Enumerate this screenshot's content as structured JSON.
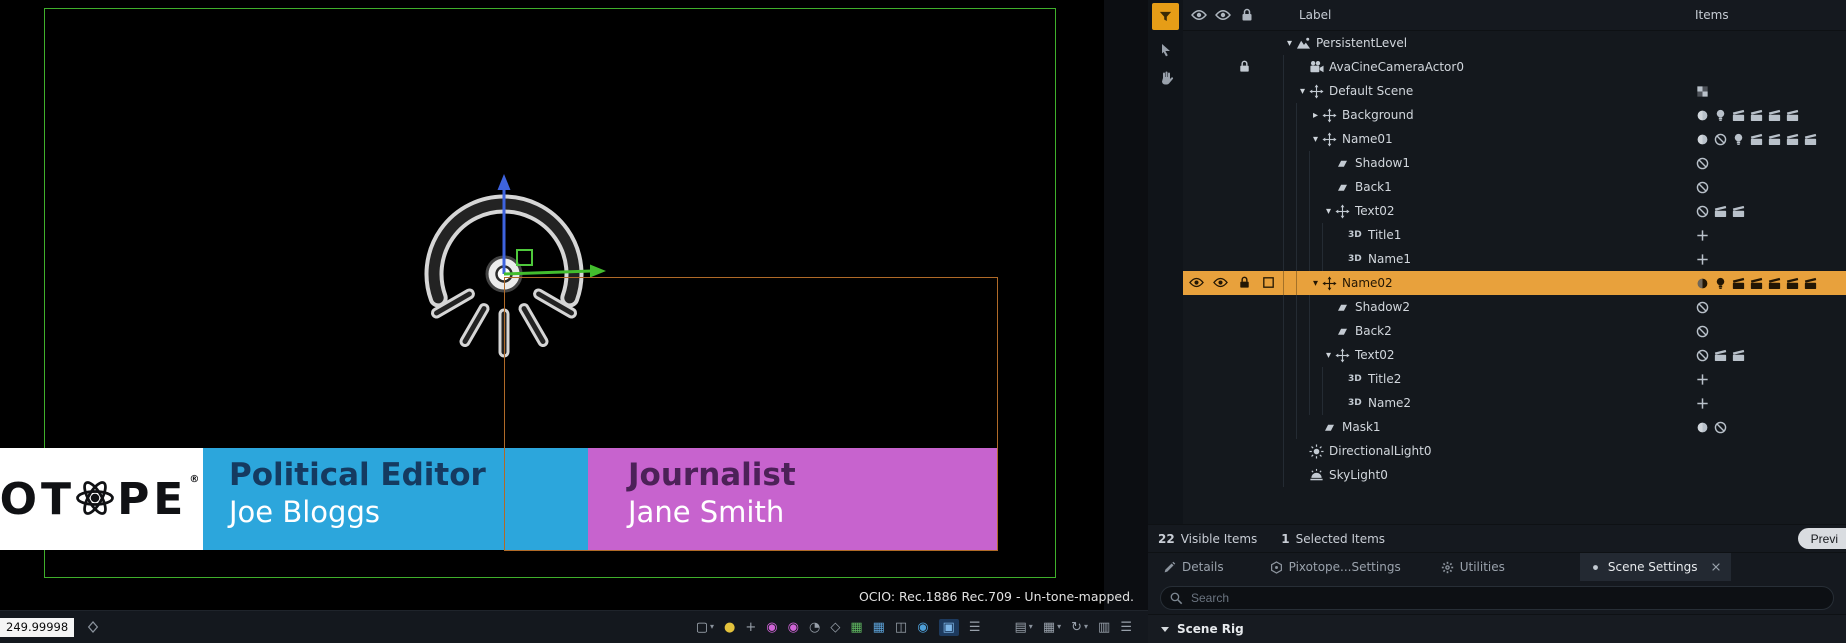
{
  "viewport": {
    "ocio_text": "OCIO: Rec.1886 Rec.709 - Un-tone-mapped.",
    "lower_thirds": {
      "logo": {
        "left": "OT",
        "right": "PE",
        "mark": "®"
      },
      "cards": [
        {
          "title": "Political Editor",
          "subtitle": "Joe Bloggs",
          "bg": "#2CA6DC",
          "title_color": "#153A60"
        },
        {
          "title": "Journalist",
          "subtitle": "Jane Smith",
          "bg": "#C763CE",
          "title_color": "#4C2158"
        }
      ]
    },
    "colors": {
      "frame_green": "#3FAF2B",
      "selection_orange": "#B06A28",
      "axis_blue": "#3E63DE",
      "axis_green": "#43BD2E"
    }
  },
  "toolbar": {
    "value_readout": "249.99998",
    "items": [
      {
        "name": "viewport-mode",
        "glyph": "▢",
        "caret": true,
        "color": "#aab2bc",
        "group": "a"
      },
      {
        "name": "marker-yellow",
        "glyph": "●",
        "color": "#e3c23c",
        "group": "a"
      },
      {
        "name": "snap-toggle",
        "glyph": "+",
        "color": "#98a0aa",
        "group": "a"
      },
      {
        "name": "marker-pink-1",
        "glyph": "◉",
        "color": "#cf64d6",
        "group": "a"
      },
      {
        "name": "marker-pink-2",
        "glyph": "◉",
        "color": "#cf64d6",
        "group": "a"
      },
      {
        "name": "show-toggle",
        "glyph": "◔",
        "color": "#98a0aa",
        "group": "a"
      },
      {
        "name": "link-toggle",
        "glyph": "◇",
        "color": "#98a0aa",
        "group": "a"
      },
      {
        "name": "rgb-channels",
        "glyph": "▦",
        "color": "#5fb560",
        "group": "a"
      },
      {
        "name": "grid-overlay",
        "glyph": "▦",
        "color": "#5a9fd4",
        "group": "a"
      },
      {
        "name": "mirror-view",
        "glyph": "◫",
        "color": "#98a0aa",
        "group": "a"
      },
      {
        "name": "camera-eye",
        "glyph": "◉",
        "color": "#4e9fd8",
        "group": "a"
      },
      {
        "name": "active-panel",
        "glyph": "▣",
        "color": "#7db6e8",
        "active": true,
        "group": "a"
      },
      {
        "name": "list-options",
        "glyph": "☰",
        "color": "#98a0aa",
        "group": "a"
      },
      {
        "name": "layer-options",
        "glyph": "▤",
        "caret": true,
        "color": "#98a0aa",
        "group": "b"
      },
      {
        "name": "grid-options",
        "glyph": "▦",
        "caret": true,
        "color": "#98a0aa",
        "group": "b"
      },
      {
        "name": "transform-cycle",
        "glyph": "↻",
        "caret": true,
        "color": "#98a0aa",
        "group": "b"
      },
      {
        "name": "screen-toggle",
        "glyph": "▥",
        "color": "#98a0aa",
        "group": "b"
      },
      {
        "name": "outline-list",
        "glyph": "☰",
        "color": "#98a0aa",
        "group": "b"
      }
    ]
  },
  "outliner": {
    "header": {
      "label_col": "Label",
      "items_col": "Items"
    },
    "selected_row_color": "#E8A13C",
    "filter_button_color": "#E69D17",
    "rows": [
      {
        "label": "PersistentLevel",
        "depth": 0,
        "chevron": "down",
        "icon": "level",
        "items": [],
        "gutter": []
      },
      {
        "label": "AvaCineCameraActor0",
        "depth": 1,
        "chevron": "none",
        "icon": "camera",
        "items": [],
        "gutter": [
          {
            "slot": 2,
            "icon": "lock"
          }
        ]
      },
      {
        "label": "Default Scene",
        "depth": 1,
        "chevron": "down",
        "icon": "move",
        "items": [
          "checker"
        ],
        "gutter": []
      },
      {
        "label": "Background",
        "depth": 2,
        "chevron": "right",
        "icon": "move",
        "items": [
          "sphere",
          "bulb",
          "clapper",
          "clapper",
          "clapper",
          "clapper"
        ],
        "gutter": []
      },
      {
        "label": "Name01",
        "depth": 2,
        "chevron": "down",
        "icon": "move",
        "items": [
          "sphere",
          "slash",
          "bulb",
          "clapper",
          "clapper",
          "clapper",
          "clapper"
        ],
        "gutter": []
      },
      {
        "label": "Shadow1",
        "depth": 3,
        "chevron": "none",
        "icon": "plane",
        "items": [
          "slash"
        ],
        "gutter": []
      },
      {
        "label": "Back1",
        "depth": 3,
        "chevron": "none",
        "icon": "plane",
        "items": [
          "slash"
        ],
        "gutter": []
      },
      {
        "label": "Text02",
        "depth": 3,
        "chevron": "down",
        "icon": "move",
        "items": [
          "slash",
          "clapper",
          "clapper"
        ],
        "gutter": []
      },
      {
        "label": "Title1",
        "depth": 4,
        "chevron": "none",
        "icon": "text3d",
        "items": [
          "cross"
        ],
        "gutter": []
      },
      {
        "label": "Name1",
        "depth": 4,
        "chevron": "none",
        "icon": "text3d",
        "items": [
          "cross"
        ],
        "gutter": []
      },
      {
        "label": "Name02",
        "depth": 2,
        "chevron": "down",
        "icon": "move",
        "selected": true,
        "items": [
          "sphere",
          "bulb",
          "clapper",
          "clapper",
          "clapper",
          "clapper",
          "clapper"
        ],
        "gutter": [
          {
            "slot": 0,
            "icon": "eye"
          },
          {
            "slot": 1,
            "icon": "eye"
          },
          {
            "slot": 2,
            "icon": "lock"
          },
          {
            "slot": 3,
            "icon": "box"
          }
        ]
      },
      {
        "label": "Shadow2",
        "depth": 3,
        "chevron": "none",
        "icon": "plane",
        "items": [
          "slash"
        ],
        "gutter": []
      },
      {
        "label": "Back2",
        "depth": 3,
        "chevron": "none",
        "icon": "plane",
        "items": [
          "slash"
        ],
        "gutter": []
      },
      {
        "label": "Text02",
        "depth": 3,
        "chevron": "down",
        "icon": "move",
        "items": [
          "slash",
          "clapper",
          "clapper"
        ],
        "gutter": []
      },
      {
        "label": "Title2",
        "depth": 4,
        "chevron": "none",
        "icon": "text3d",
        "items": [
          "cross"
        ],
        "gutter": []
      },
      {
        "label": "Name2",
        "depth": 4,
        "chevron": "none",
        "icon": "text3d",
        "items": [
          "cross"
        ],
        "gutter": []
      },
      {
        "label": "Mask1",
        "depth": 2,
        "chevron": "none",
        "icon": "plane",
        "items": [
          "sphere",
          "slash"
        ],
        "gutter": []
      },
      {
        "label": "DirectionalLight0",
        "depth": 1,
        "chevron": "none",
        "icon": "sun",
        "items": [],
        "gutter": []
      },
      {
        "label": "SkyLight0",
        "depth": 1,
        "chevron": "none",
        "icon": "skylight",
        "items": [],
        "gutter": []
      }
    ],
    "footer": {
      "visible_count": "22",
      "visible_label": "Visible Items",
      "selected_count": "1",
      "selected_label": "Selected Items",
      "preview_button": "Previ"
    }
  },
  "tabs": [
    {
      "label": "Details",
      "icon": "pencil"
    },
    {
      "label": "Pixotope...Settings",
      "icon": "hex"
    },
    {
      "label": "Utilities",
      "icon": "gear"
    },
    {
      "label": "Scene Settings",
      "icon": "dot",
      "active": true
    }
  ],
  "search": {
    "placeholder": "Search"
  },
  "scene_rig": {
    "label": "Scene Rig"
  }
}
